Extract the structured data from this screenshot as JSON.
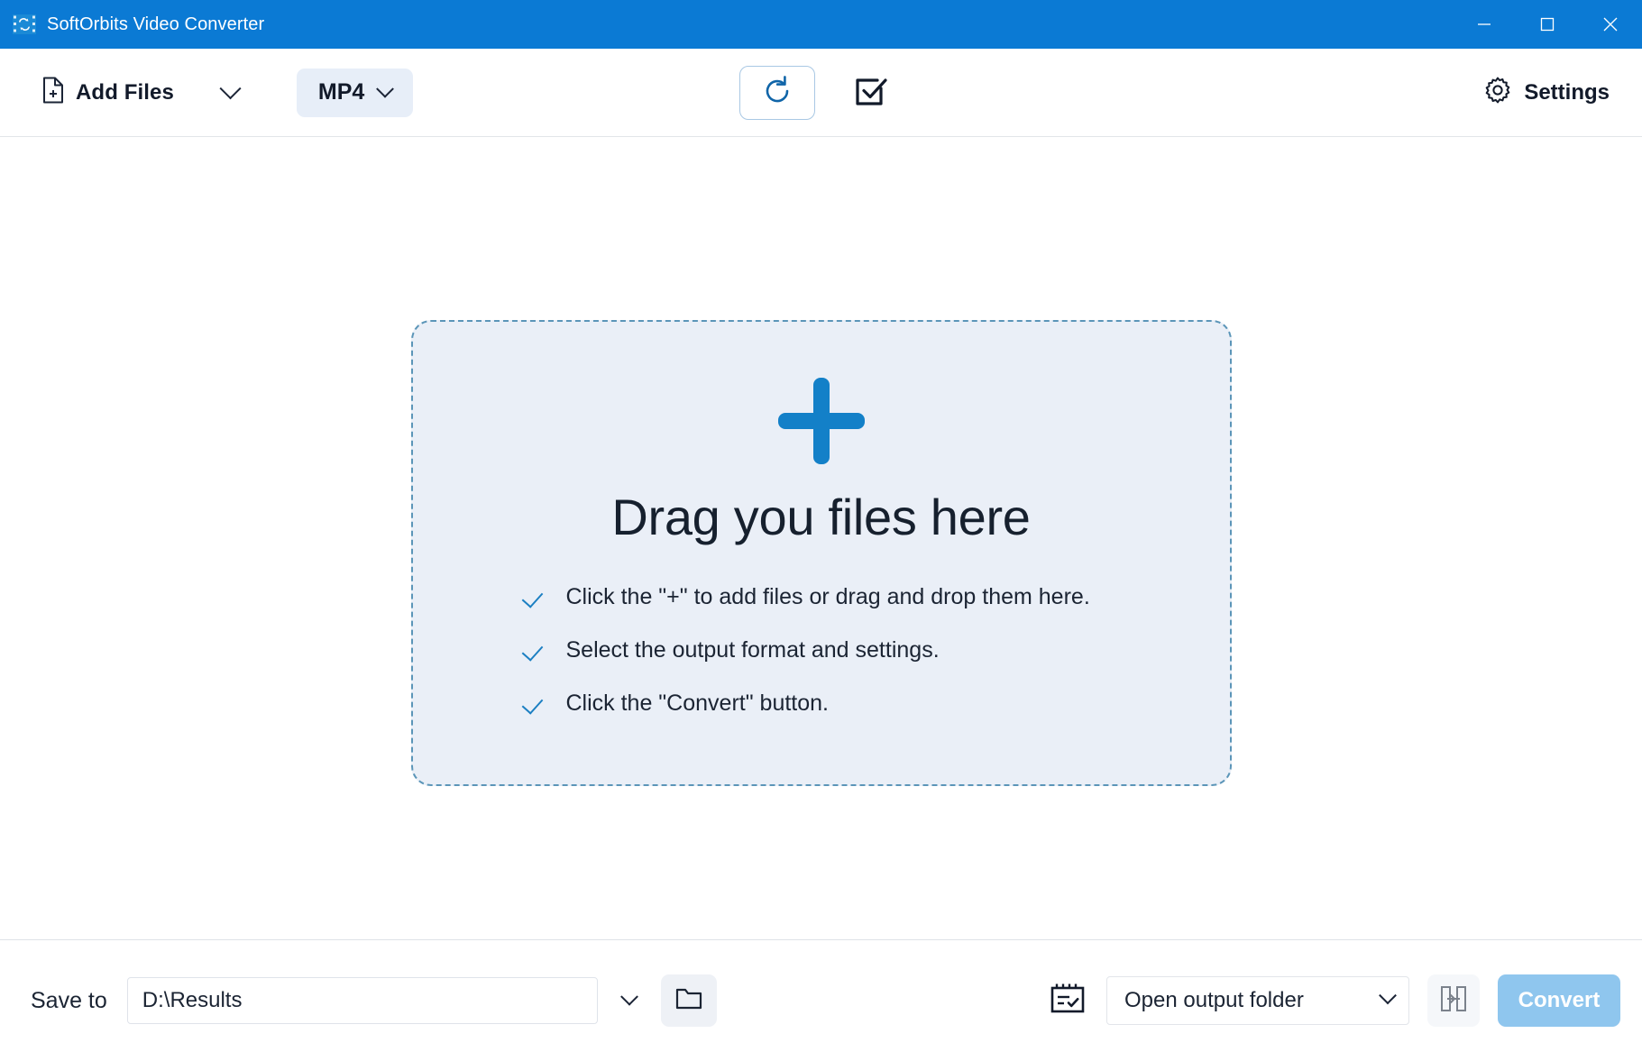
{
  "window": {
    "title": "SoftOrbits Video Converter",
    "app_icon": "film-converter-icon",
    "titlebar_color": "#0b7ad4",
    "controls": {
      "minimize": "minimize-icon",
      "maximize": "maximize-icon",
      "close": "close-icon"
    }
  },
  "toolbar": {
    "add_files_label": "Add Files",
    "add_files_icon": "file-plus-icon",
    "add_files_chevron": "chevron-down-icon",
    "format_value": "MP4",
    "format_chevron": "chevron-down-icon",
    "refresh_icon": "refresh-icon",
    "select_all_icon": "checkbox-checked-icon",
    "settings_label": "Settings",
    "settings_icon": "gear-icon",
    "accent_color": "#1380c8"
  },
  "dropzone": {
    "plus_icon": "plus-icon",
    "title": "Drag you files here",
    "background": "#eaeff7",
    "border_color": "#5b95b8",
    "items": [
      {
        "tick_icon": "check-icon",
        "text": "Click the \"+\" to add files or drag and drop them here."
      },
      {
        "tick_icon": "check-icon",
        "text": "Select the output format and settings."
      },
      {
        "tick_icon": "check-icon",
        "text": "Click the \"Convert\" button."
      }
    ]
  },
  "bottom": {
    "save_to_label": "Save to",
    "path_value": "D:\\Results",
    "path_chevron": "chevron-down-icon",
    "folder_icon": "folder-icon",
    "schedule_icon": "calendar-check-icon",
    "after_conversion_value": "Open output folder",
    "after_conversion_chevron": "chevron-down-icon",
    "merge_icon": "merge-icon",
    "convert_label": "Convert",
    "convert_color": "#8fc6ee"
  }
}
